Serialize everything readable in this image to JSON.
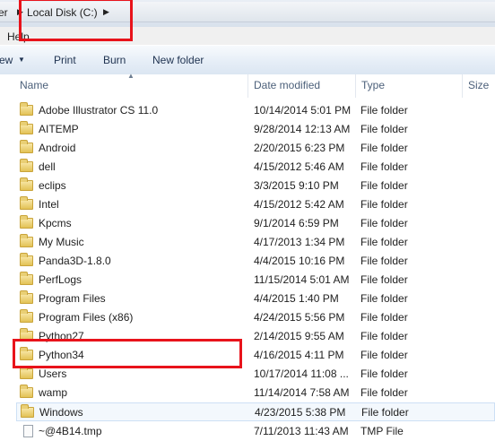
{
  "address": {
    "crumb_prev": "er",
    "crumb_current": "Local Disk (C:)"
  },
  "menu": {
    "help": "Help"
  },
  "toolbar": {
    "view": "ew",
    "print": "Print",
    "burn": "Burn",
    "new_folder": "New folder"
  },
  "columns": {
    "name": "Name",
    "date": "Date modified",
    "type": "Type",
    "size": "Size"
  },
  "rows": [
    {
      "name": "Adobe Illustrator CS 11.0",
      "date": "10/14/2014 5:01 PM",
      "type": "File folder"
    },
    {
      "name": "AITEMP",
      "date": "9/28/2014 12:13 AM",
      "type": "File folder"
    },
    {
      "name": "Android",
      "date": "2/20/2015 6:23 PM",
      "type": "File folder"
    },
    {
      "name": "dell",
      "date": "4/15/2012 5:46 AM",
      "type": "File folder"
    },
    {
      "name": "eclips",
      "date": "3/3/2015 9:10 PM",
      "type": "File folder"
    },
    {
      "name": "Intel",
      "date": "4/15/2012 5:42 AM",
      "type": "File folder"
    },
    {
      "name": "Kpcms",
      "date": "9/1/2014 6:59 PM",
      "type": "File folder"
    },
    {
      "name": "My Music",
      "date": "4/17/2013 1:34 PM",
      "type": "File folder"
    },
    {
      "name": "Panda3D-1.8.0",
      "date": "4/4/2015 10:16 PM",
      "type": "File folder"
    },
    {
      "name": "PerfLogs",
      "date": "11/15/2014 5:01 AM",
      "type": "File folder"
    },
    {
      "name": "Program Files",
      "date": "4/4/2015 1:40 PM",
      "type": "File folder"
    },
    {
      "name": "Program Files (x86)",
      "date": "4/24/2015 5:56 PM",
      "type": "File folder"
    },
    {
      "name": "Python27",
      "date": "2/14/2015 9:55 AM",
      "type": "File folder"
    },
    {
      "name": "Python34",
      "date": "4/16/2015 4:11 PM",
      "type": "File folder"
    },
    {
      "name": "Users",
      "date": "10/17/2014 11:08 ...",
      "type": "File folder"
    },
    {
      "name": "wamp",
      "date": "11/14/2014 7:58 AM",
      "type": "File folder"
    },
    {
      "name": "Windows",
      "date": "4/23/2015 5:38 PM",
      "type": "File folder"
    },
    {
      "name": "~@4B14.tmp",
      "date": "7/11/2013 11:43 AM",
      "type": "TMP File"
    }
  ],
  "colors": {
    "highlight_box": "#e8131b",
    "toolbar_text": "#1e3250",
    "header_text": "#4c607a"
  }
}
